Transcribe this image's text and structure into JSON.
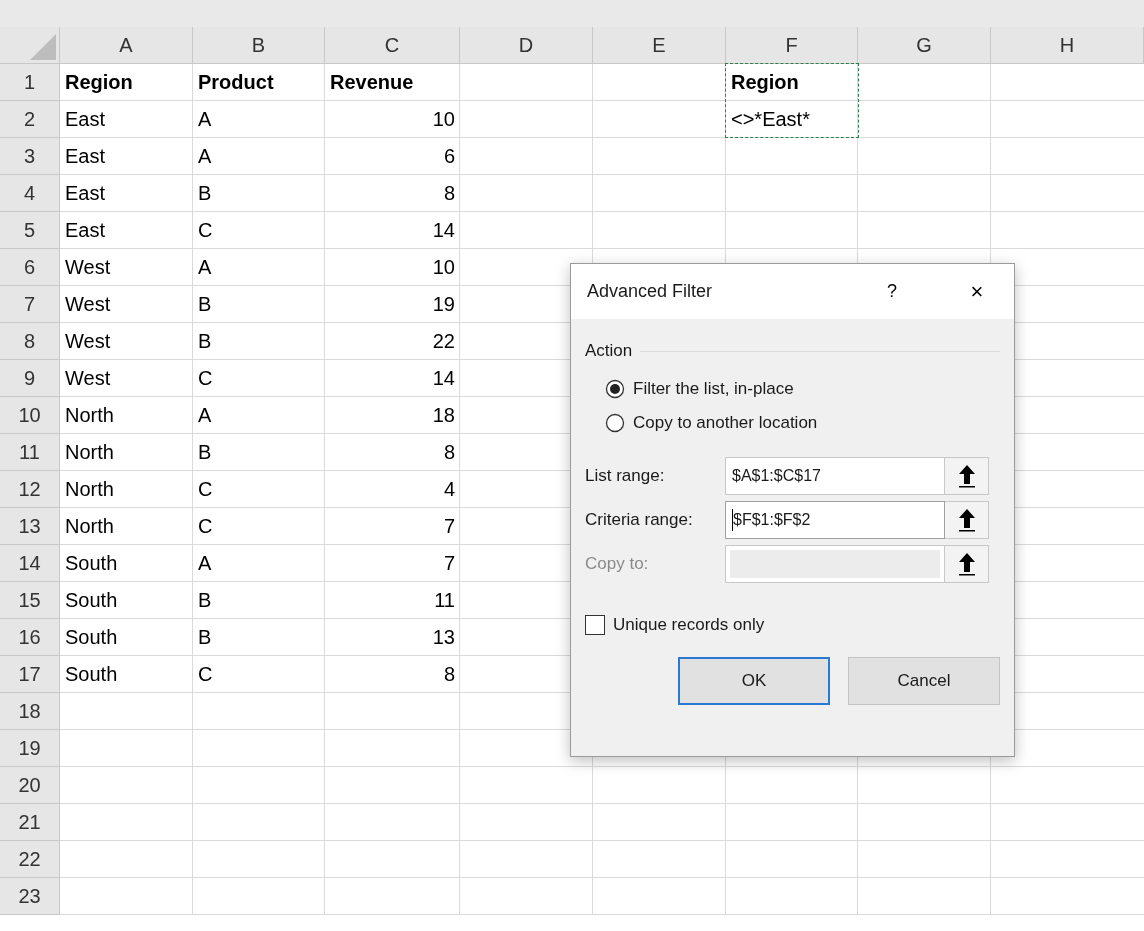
{
  "sheet": {
    "columns": [
      "A",
      "B",
      "C",
      "D",
      "E",
      "F",
      "G",
      "H"
    ],
    "criteria_marquee": true,
    "rows": [
      {
        "number": "1",
        "cells": [
          {
            "kind": "header",
            "text": "Region"
          },
          {
            "kind": "header",
            "text": "Product"
          },
          {
            "kind": "header",
            "text": "Revenue"
          },
          {},
          {},
          {
            "kind": "header",
            "text": "Region"
          }
        ]
      },
      {
        "number": "2",
        "cells": [
          {
            "kind": "text",
            "text": "East"
          },
          {
            "kind": "text",
            "text": "A"
          },
          {
            "kind": "number",
            "text": "10"
          },
          {},
          {},
          {
            "kind": "text",
            "text": "<>*East*"
          }
        ]
      },
      {
        "number": "3",
        "cells": [
          {
            "kind": "text",
            "text": "East"
          },
          {
            "kind": "text",
            "text": "A"
          },
          {
            "kind": "number",
            "text": "6"
          }
        ]
      },
      {
        "number": "4",
        "cells": [
          {
            "kind": "text",
            "text": "East"
          },
          {
            "kind": "text",
            "text": "B"
          },
          {
            "kind": "number",
            "text": "8"
          }
        ]
      },
      {
        "number": "5",
        "cells": [
          {
            "kind": "text",
            "text": "East"
          },
          {
            "kind": "text",
            "text": "C"
          },
          {
            "kind": "number",
            "text": "14"
          }
        ]
      },
      {
        "number": "6",
        "cells": [
          {
            "kind": "text",
            "text": "West"
          },
          {
            "kind": "text",
            "text": "A"
          },
          {
            "kind": "number",
            "text": "10"
          }
        ]
      },
      {
        "number": "7",
        "cells": [
          {
            "kind": "text",
            "text": "West"
          },
          {
            "kind": "text",
            "text": "B"
          },
          {
            "kind": "number",
            "text": "19"
          }
        ]
      },
      {
        "number": "8",
        "cells": [
          {
            "kind": "text",
            "text": "West"
          },
          {
            "kind": "text",
            "text": "B"
          },
          {
            "kind": "number",
            "text": "22"
          }
        ]
      },
      {
        "number": "9",
        "cells": [
          {
            "kind": "text",
            "text": "West"
          },
          {
            "kind": "text",
            "text": "C"
          },
          {
            "kind": "number",
            "text": "14"
          }
        ]
      },
      {
        "number": "10",
        "cells": [
          {
            "kind": "text",
            "text": "North"
          },
          {
            "kind": "text",
            "text": "A"
          },
          {
            "kind": "number",
            "text": "18"
          }
        ]
      },
      {
        "number": "11",
        "cells": [
          {
            "kind": "text",
            "text": "North"
          },
          {
            "kind": "text",
            "text": "B"
          },
          {
            "kind": "number",
            "text": "8"
          }
        ]
      },
      {
        "number": "12",
        "cells": [
          {
            "kind": "text",
            "text": "North"
          },
          {
            "kind": "text",
            "text": "C"
          },
          {
            "kind": "number",
            "text": "4"
          }
        ]
      },
      {
        "number": "13",
        "cells": [
          {
            "kind": "text",
            "text": "North"
          },
          {
            "kind": "text",
            "text": "C"
          },
          {
            "kind": "number",
            "text": "7"
          }
        ]
      },
      {
        "number": "14",
        "cells": [
          {
            "kind": "text",
            "text": "South"
          },
          {
            "kind": "text",
            "text": "A"
          },
          {
            "kind": "number",
            "text": "7"
          }
        ]
      },
      {
        "number": "15",
        "cells": [
          {
            "kind": "text",
            "text": "South"
          },
          {
            "kind": "text",
            "text": "B"
          },
          {
            "kind": "number",
            "text": "11"
          }
        ]
      },
      {
        "number": "16",
        "cells": [
          {
            "kind": "text",
            "text": "South"
          },
          {
            "kind": "text",
            "text": "B"
          },
          {
            "kind": "number",
            "text": "13"
          }
        ]
      },
      {
        "number": "17",
        "cells": [
          {
            "kind": "text",
            "text": "South"
          },
          {
            "kind": "text",
            "text": "C"
          },
          {
            "kind": "number",
            "text": "8"
          }
        ]
      },
      {
        "number": "18",
        "cells": []
      },
      {
        "number": "19",
        "cells": []
      },
      {
        "number": "20",
        "cells": []
      },
      {
        "number": "21",
        "cells": []
      },
      {
        "number": "22",
        "cells": []
      },
      {
        "number": "23",
        "cells": []
      }
    ]
  },
  "dialog": {
    "title": "Advanced Filter",
    "help": "?",
    "close": "×",
    "section": "Action",
    "radios": [
      {
        "label": "Filter the list, in-place",
        "selected": true
      },
      {
        "label": "Copy to another location",
        "selected": false
      }
    ],
    "fields": [
      {
        "label": "List range:",
        "value": "$A$1:$C$17",
        "disabled": false,
        "focused": false
      },
      {
        "label": "Criteria range:",
        "value": "$F$1:$F$2",
        "disabled": false,
        "focused": true
      },
      {
        "label": "Copy to:",
        "disabled": true,
        "focused": false
      }
    ],
    "checkbox": {
      "label": "Unique records only",
      "checked": false
    },
    "buttons": [
      {
        "label": "OK",
        "default": true
      },
      {
        "label": "Cancel",
        "default": false
      }
    ]
  }
}
